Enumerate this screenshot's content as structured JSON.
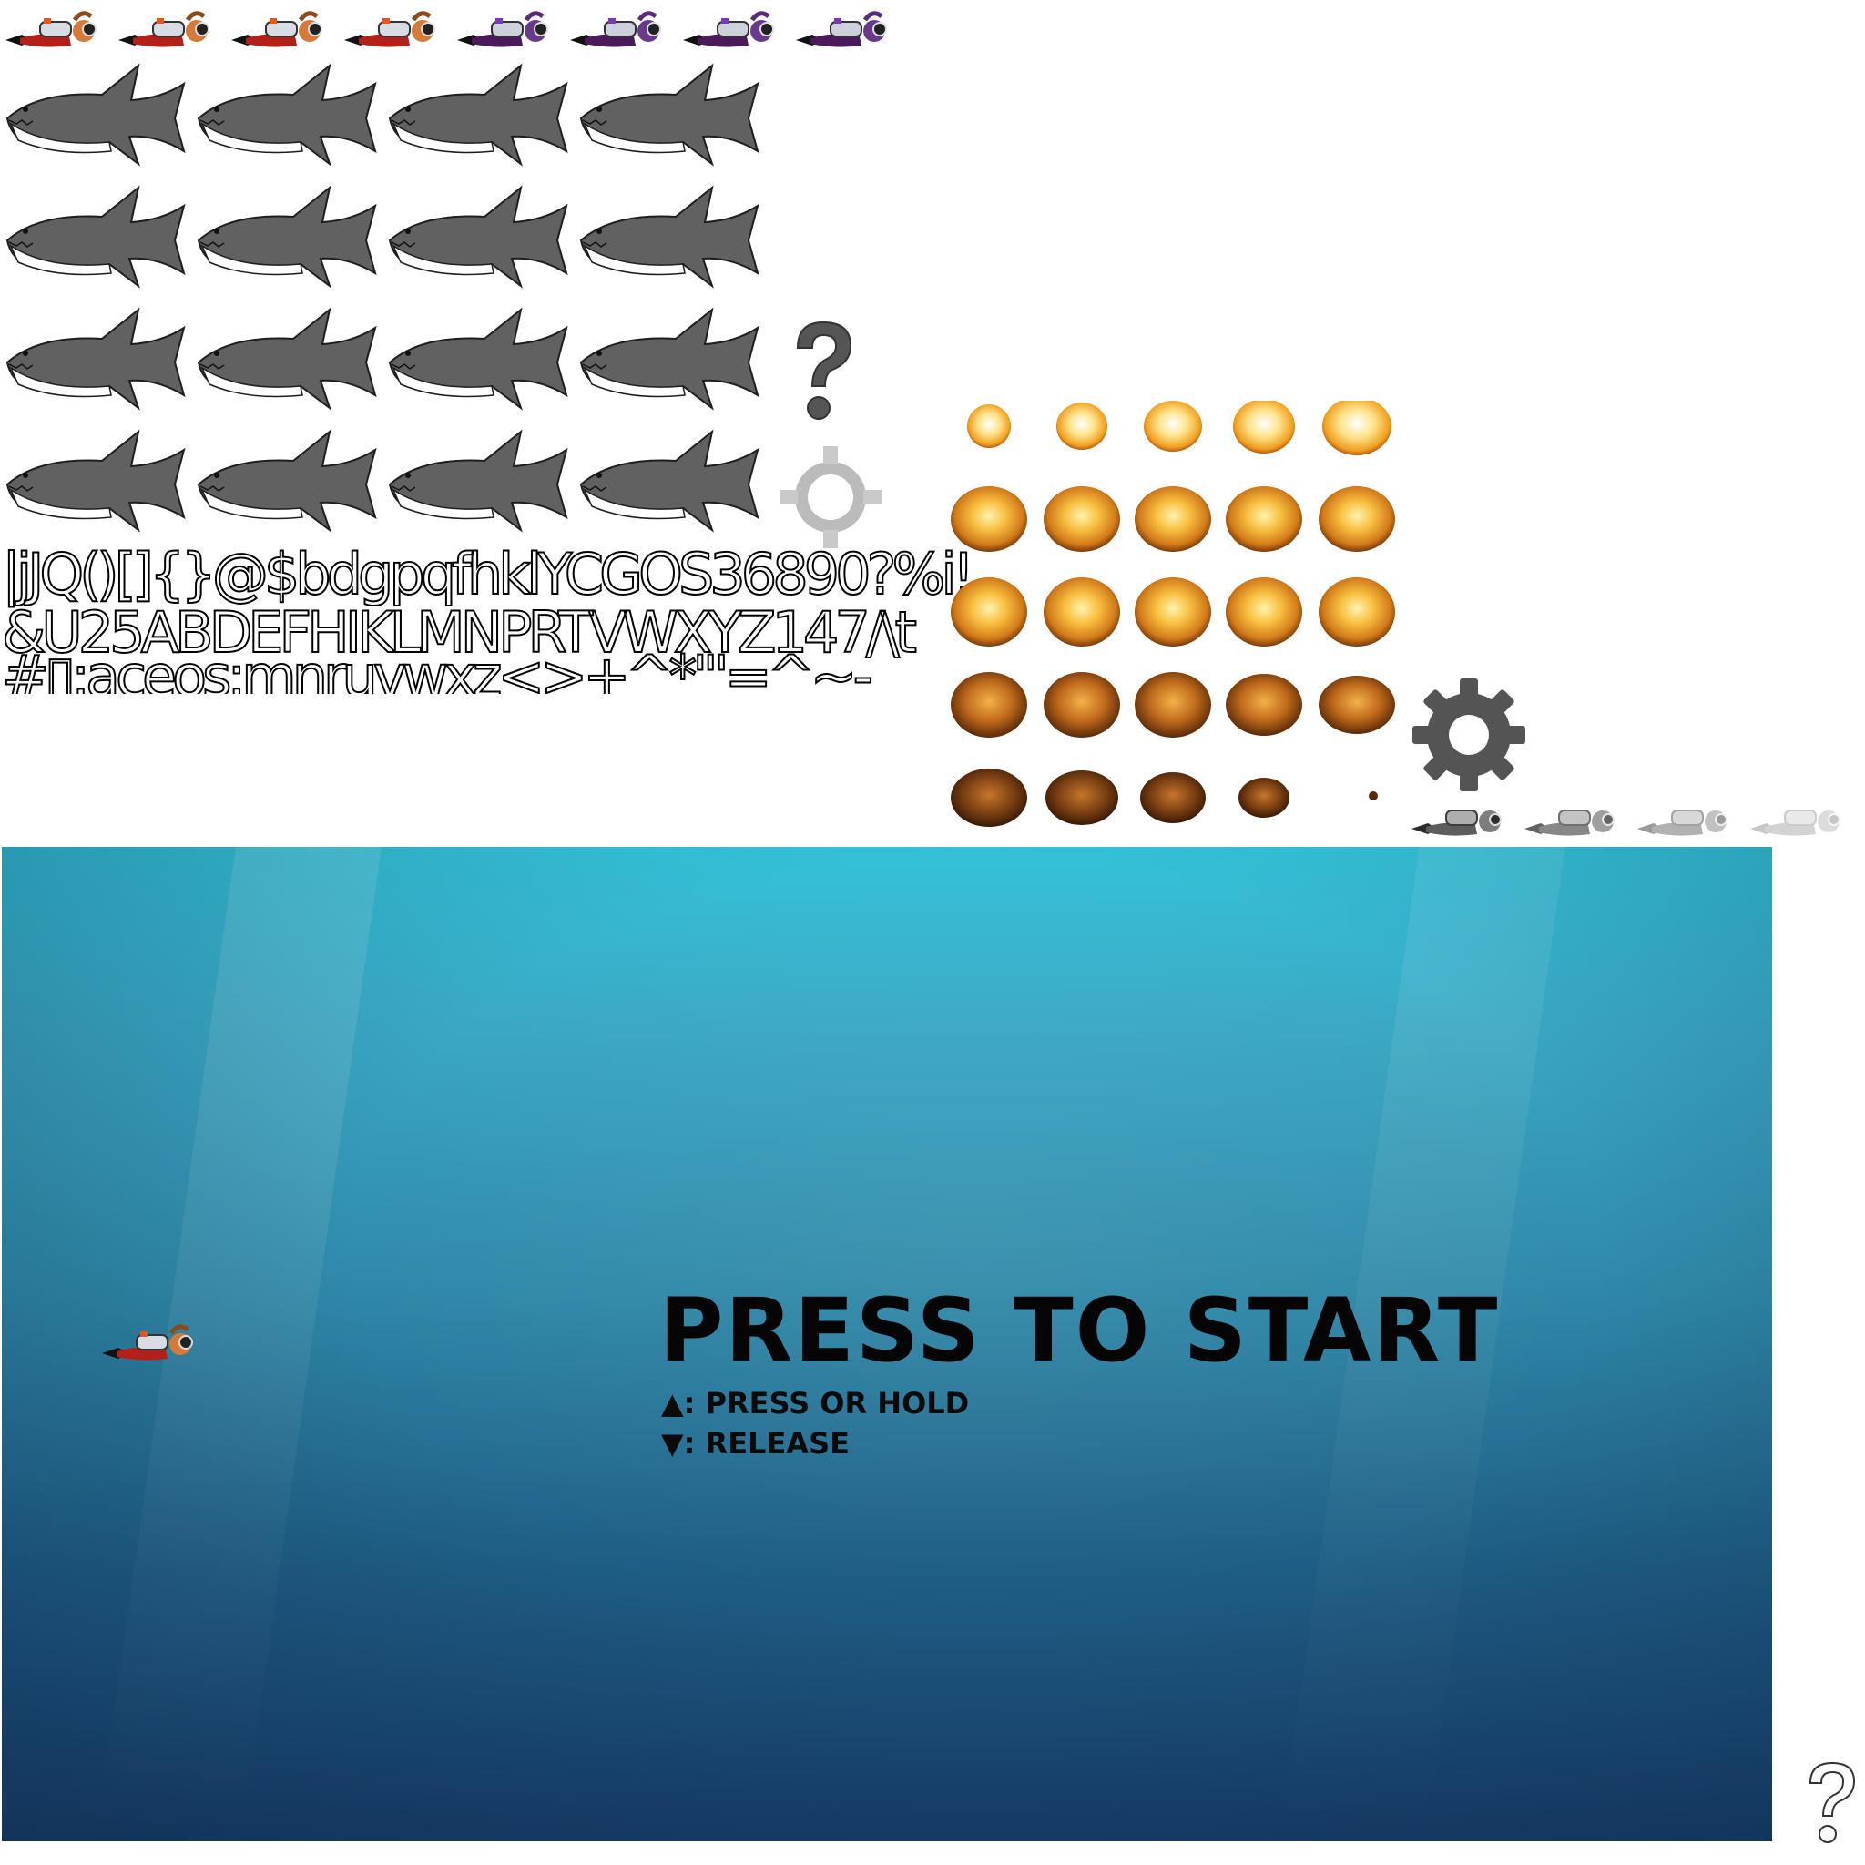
{
  "atlas": {
    "diver_frames": [
      {
        "palette": "orange"
      },
      {
        "palette": "orange"
      },
      {
        "palette": "orange"
      },
      {
        "palette": "orange"
      },
      {
        "palette": "purple"
      },
      {
        "palette": "purple"
      },
      {
        "palette": "purple"
      },
      {
        "palette": "purple"
      }
    ],
    "shark_grid": {
      "rows": 4,
      "cols": 4
    },
    "font_glyph_rows": [
      "|jJQ()[]{}@$bdgpqfhklYCGOS36890?%i!",
      "&U25ABDEFHIKLMNPRTVWXYZ147/\\t",
      "#▯;aceos:mnruvwxz<>+^*\"'=^~-_"
    ],
    "help_icon": "question-mark-icon",
    "gear_icon": "gear-icon",
    "explosion_grid": {
      "rows": 5,
      "cols": 5
    },
    "dead_diver_frames": 4
  },
  "game": {
    "title": "PRESS TO START",
    "controls": [
      {
        "key": "▲",
        "text": ": PRESS OR HOLD"
      },
      {
        "key": "▼",
        "text": ": RELEASE"
      }
    ]
  },
  "colors": {
    "water_top": "#34c3d9",
    "water_bottom": "#173f6a",
    "shark": "#5f5f5f",
    "text": "#050505"
  }
}
